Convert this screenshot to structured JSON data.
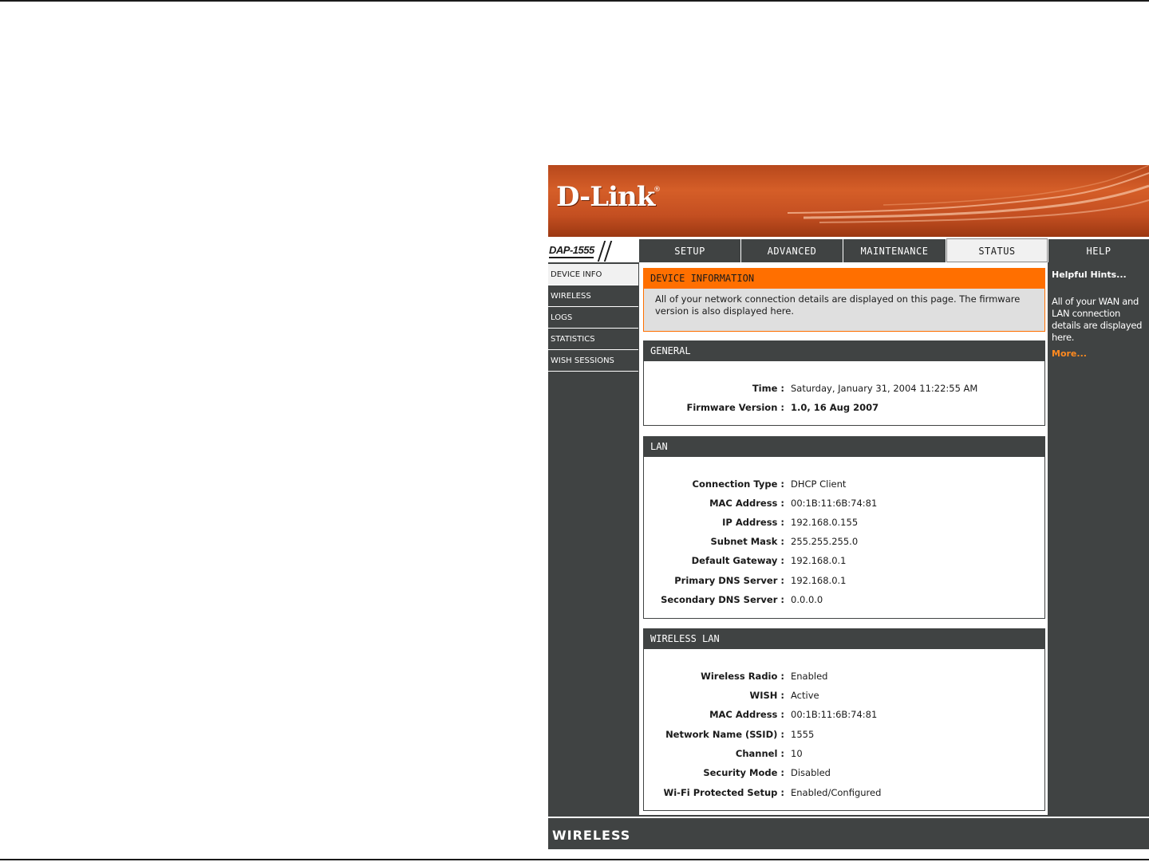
{
  "brand": {
    "logo_text": "D-Link",
    "logo_mark": "®",
    "model": "DAP-1555"
  },
  "colors": {
    "banner": "#c44f21",
    "nav_bg": "#404343",
    "accent_orange": "#ff6f00",
    "link_orange": "#ff8a1f",
    "info_bg": "#dfdfdf"
  },
  "nav": {
    "tabs": [
      {
        "label": "SETUP",
        "active": false
      },
      {
        "label": "ADVANCED",
        "active": false
      },
      {
        "label": "MAINTENANCE",
        "active": false
      },
      {
        "label": "STATUS",
        "active": true
      },
      {
        "label": "HELP",
        "active": false
      }
    ]
  },
  "sidebar": {
    "items": [
      {
        "label": "DEVICE INFO",
        "active": true
      },
      {
        "label": "WIRELESS",
        "active": false
      },
      {
        "label": "LOGS",
        "active": false
      },
      {
        "label": "STATISTICS",
        "active": false
      },
      {
        "label": "WISH SESSIONS",
        "active": false
      }
    ]
  },
  "device_info": {
    "title": "DEVICE INFORMATION",
    "description": "All of your network connection details are displayed on this page. The firmware version is also displayed here."
  },
  "general": {
    "title": "GENERAL",
    "rows": [
      {
        "label": "Time :",
        "value": "Saturday, January 31, 2004 11:22:55 AM"
      },
      {
        "label": "Firmware Version :",
        "value": "1.0,  16 Aug 2007"
      }
    ]
  },
  "lan": {
    "title": "LAN",
    "rows": [
      {
        "label": "Connection Type :",
        "value": "DHCP Client"
      },
      {
        "label": "MAC Address :",
        "value": "00:1B:11:6B:74:81"
      },
      {
        "label": "IP Address :",
        "value": "192.168.0.155"
      },
      {
        "label": "Subnet Mask :",
        "value": "255.255.255.0"
      },
      {
        "label": "Default Gateway :",
        "value": "192.168.0.1"
      },
      {
        "label": "Primary DNS Server :",
        "value": "192.168.0.1"
      },
      {
        "label": "Secondary DNS Server :",
        "value": "0.0.0.0"
      }
    ]
  },
  "wireless_lan": {
    "title": "WIRELESS LAN",
    "rows": [
      {
        "label": "Wireless Radio :",
        "value": "Enabled"
      },
      {
        "label": "WISH :",
        "value": "Active"
      },
      {
        "label": "MAC Address :",
        "value": "00:1B:11:6B:74:81"
      },
      {
        "label": "Network Name (SSID) :",
        "value": "1555"
      },
      {
        "label": "Channel :",
        "value": "10"
      },
      {
        "label": "Security Mode :",
        "value": "Disabled"
      },
      {
        "label": "Wi-Fi Protected Setup :",
        "value": "Enabled/Configured"
      }
    ]
  },
  "help": {
    "title": "Helpful Hints...",
    "text": "All of your WAN and LAN connection details are displayed here.",
    "more": "More..."
  },
  "footer": {
    "label": "WIRELESS"
  }
}
